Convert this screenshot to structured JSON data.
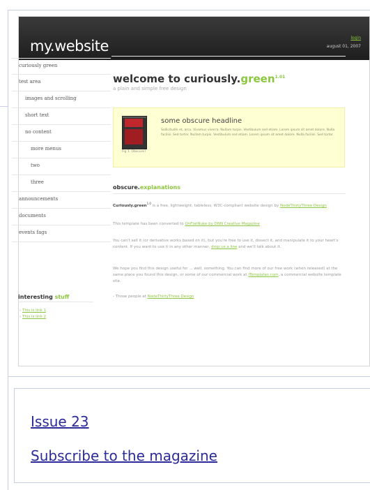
{
  "site": {
    "logo": "my.website",
    "login": "login",
    "date": "august 01, 2007",
    "nav": [
      {
        "label": "curiously green",
        "level": 0
      },
      {
        "label": "test area",
        "level": 0
      },
      {
        "label": "images and scrolling",
        "level": 1
      },
      {
        "label": "short text",
        "level": 1
      },
      {
        "label": "no content",
        "level": 1
      },
      {
        "label": "more menus",
        "level": 2
      },
      {
        "label": "two",
        "level": 2
      },
      {
        "label": "three",
        "level": 2
      },
      {
        "label": "announcements",
        "level": 0
      },
      {
        "label": "documents",
        "level": 0
      },
      {
        "label": "events fags",
        "level": 0
      }
    ],
    "interesting": {
      "title_a": "interesting ",
      "title_b": "stuff",
      "link1": "This is link 1",
      "link2": "This is link 2"
    },
    "welcome": {
      "title_a": "welcome to curiously.",
      "title_b": "green",
      "version": "1.01",
      "tagline": "a plain and simple free design"
    },
    "feature": {
      "title": "some obscure headline",
      "fig": "Fig 1. Obscure?",
      "text": "Sollicitudin et, arcu. Vivamus viverra. Nullam turpis. Vestibulum sed etiam. Lorem ipsum sit amet dolore. Nulla facilisi. Sed tortor. Nullam turpis. Vestibulum sed etiam. Lorem ipsum sit amet dolore. Nulla facilisi. Sed tortor."
    },
    "explain": {
      "title_a": "obscure.",
      "title_b": "explanations"
    },
    "paragraphs": {
      "p1_bold": "Curiously.green",
      "p1_sup": "1.0",
      "p1_text": " is a free, lightweight, tableless, W3C-compliant website design by ",
      "p1_link": "NodeThirtyThree Design",
      "p2_text": "This template has been converted to ",
      "p2_link": "OnFlatNuke by DNN Creative Magazine",
      "p3_text": "You can't sell it (or derivative works based on it), but you're free to use it, dissect it, and manipulate it to your heart's content. If you want to use it in any other manner, ",
      "p3_link": "drop us a line",
      "p3_tail": " and we'll talk about it.",
      "p4_text": "We hope you find this design useful for ... well, something. You can find more of our free work (when released) at the same place you found this design, or some of our commercial work at ",
      "p4_link": "ITemplates.com",
      "p4_tail": ", a commercial website template site.",
      "p5_text": "- Those people at ",
      "p5_link": "NodeThirtyThree Design"
    }
  },
  "links": {
    "issue": "Issue 23",
    "subscribe": "Subscribe to the magazine"
  }
}
